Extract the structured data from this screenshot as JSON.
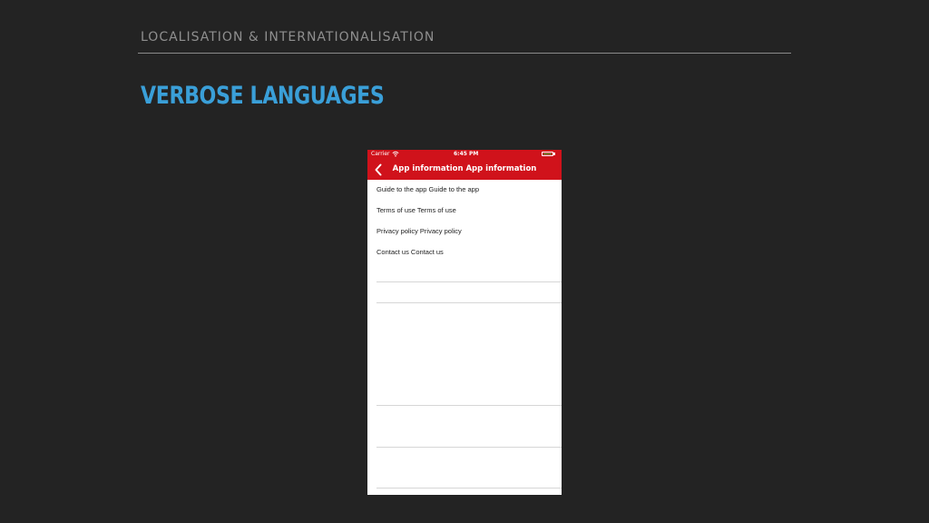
{
  "slide": {
    "header": "LOCALISATION & INTERNATIONALISATION",
    "title": "VERBOSE LANGUAGES"
  },
  "phone": {
    "status_bar": {
      "carrier": "Carrier",
      "time": "6:45 PM"
    },
    "nav_bar": {
      "title": "App information App information",
      "back_icon": "chevron-left-icon"
    },
    "menu_items": [
      "Guide to the app Guide to the app",
      "Terms of use Terms of use",
      "Privacy policy Privacy policy",
      "Contact us Contact us"
    ]
  },
  "colors": {
    "background": "#232323",
    "title_accent": "#3a9fd8",
    "navbar": "#d0121b",
    "header_text": "#8f8f8f"
  }
}
